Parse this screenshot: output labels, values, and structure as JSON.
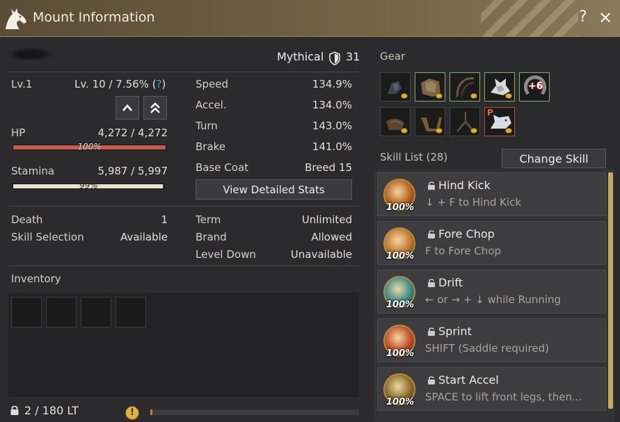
{
  "window": {
    "title": "Mount Information",
    "help": "?",
    "close": "✕"
  },
  "mount": {
    "tier": "Mythical",
    "tier_value": "31",
    "level_label": "Lv.1",
    "level_progress": "Lv. 10 / 7.56% (",
    "level_help": "?",
    "level_progress_close": ")",
    "hp": {
      "label": "HP",
      "value": "4,272 / 4,272",
      "percent": "100%",
      "fill": 1.0,
      "color": "#cc5a4a"
    },
    "stamina": {
      "label": "Stamina",
      "value": "5,987 / 5,997",
      "percent": "99%",
      "fill": 0.99,
      "color": "#e8e0cc"
    },
    "death": {
      "label": "Death",
      "value": "1"
    },
    "skill_selection": {
      "label": "Skill Selection",
      "value": "Available"
    }
  },
  "stats": [
    {
      "label": "Speed",
      "value": "134.9%"
    },
    {
      "label": "Accel.",
      "value": "134.0%"
    },
    {
      "label": "Turn",
      "value": "143.0%"
    },
    {
      "label": "Brake",
      "value": "141.0%"
    },
    {
      "label": "Base Coat",
      "value": "Breed 15"
    }
  ],
  "view_detailed_stats": "View Detailed Stats",
  "terms": [
    {
      "label": "Term",
      "value": "Unlimited"
    },
    {
      "label": "Brand",
      "value": "Allowed"
    },
    {
      "label": "Level Down",
      "value": "Unavailable"
    }
  ],
  "inventory": {
    "title": "Inventory",
    "weight": "2 / 180 LT",
    "weight_fill": 0.011,
    "warn": "!"
  },
  "gear": {
    "title": "Gear",
    "enhance_label": "+6",
    "p_label": "P"
  },
  "skills": {
    "title": "Skill List (28)",
    "change_button": "Change Skill",
    "items": [
      {
        "name": "Hind Kick",
        "desc": "↓ + F to Hind Kick",
        "percent": "100%",
        "color": "#b8601e"
      },
      {
        "name": "Fore Chop",
        "desc": "F to Fore Chop",
        "percent": "100%",
        "color": "#c07830"
      },
      {
        "name": "Drift",
        "desc": "← or → + ↓ while Running",
        "percent": "100%",
        "color": "#3a8a8c"
      },
      {
        "name": "Sprint",
        "desc": "SHIFT (Saddle required)",
        "percent": "100%",
        "color": "#c04a2a"
      },
      {
        "name": "Start Accel",
        "desc": "SPACE to lift front legs, then...",
        "percent": "100%",
        "color": "#8a6a2a"
      }
    ]
  },
  "colors": {
    "accent": "#c8a860",
    "title_bar": "#6b5b3f"
  }
}
